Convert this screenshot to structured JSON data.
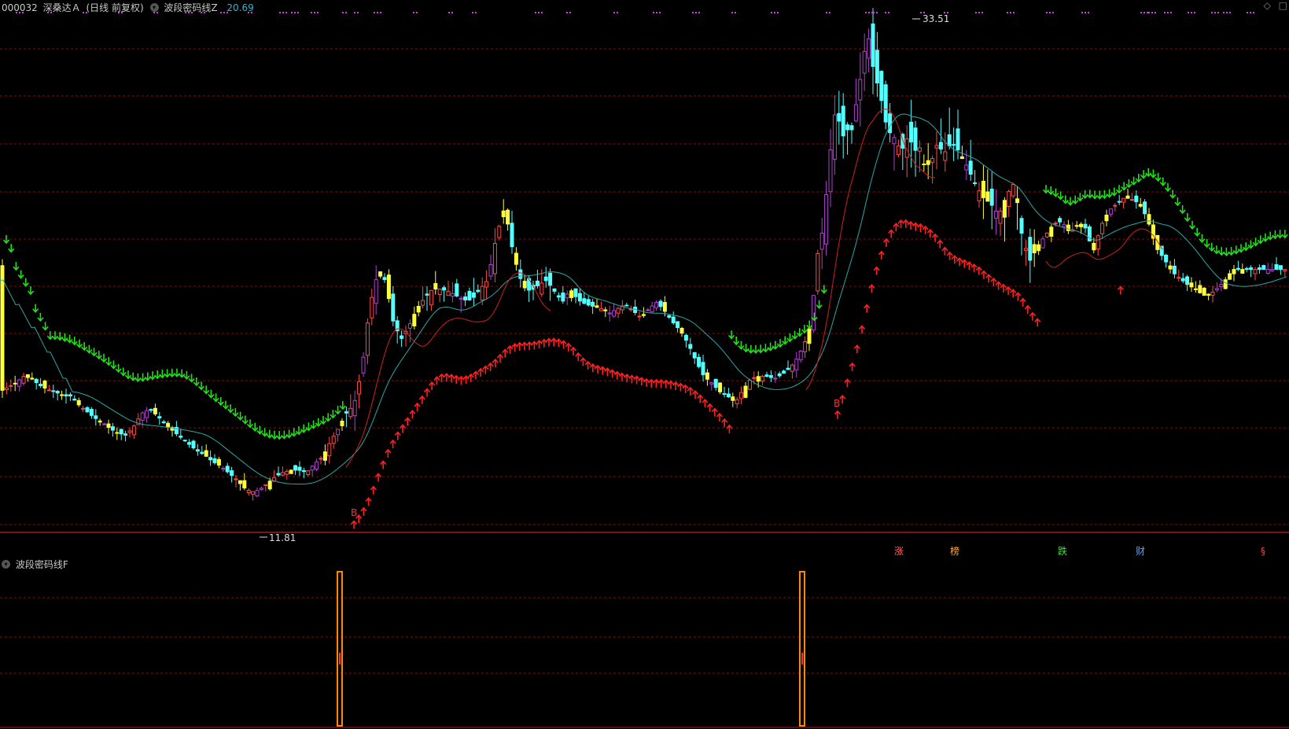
{
  "header": {
    "symbol": "000032",
    "name": "深桑达Ａ",
    "period": "(日线 前复权)",
    "indicator": "波段密码线Z",
    "price": "20.69"
  },
  "sub_panel": {
    "title": "波段密码线F"
  },
  "annotations": {
    "high_label": "33.51",
    "low_label": "11.81",
    "buy_marker": "B"
  },
  "events": [
    "涨",
    "榜",
    "跌",
    "财",
    "§"
  ],
  "colors": {
    "background": "#000000",
    "up": "#ff4a4a",
    "down": "#54ffff",
    "sell_arrow": "#22e01a",
    "buy_arrow": "#ff2020",
    "signal_bar": "#ff8800",
    "grid": "#7a1010",
    "magenta": "#c83ce6",
    "upper_magenta": "#b040d0",
    "yellow": "#ffff40",
    "ma_line": "#2aa8a8",
    "red_line": "#d02020",
    "price_text": "#27b8d8"
  },
  "icons": {
    "collapse": "collapse-icon",
    "diamond": "diamond-icon",
    "pin": "pin-icon"
  },
  "chart_data": {
    "type": "candlestick",
    "y_range": [
      11.0,
      34.5
    ],
    "close_series": [
      [
        0,
        17.2
      ],
      [
        10,
        17.4
      ],
      [
        20,
        17.6
      ],
      [
        30,
        17.9
      ],
      [
        40,
        17.8
      ],
      [
        50,
        17.5
      ],
      [
        60,
        17.3
      ],
      [
        70,
        17.2
      ],
      [
        80,
        17.0
      ],
      [
        90,
        17.0
      ],
      [
        100,
        16.6
      ],
      [
        110,
        16.3
      ],
      [
        120,
        16.0
      ],
      [
        130,
        15.8
      ],
      [
        140,
        15.5
      ],
      [
        150,
        15.3
      ],
      [
        160,
        15.2
      ],
      [
        170,
        15.6
      ],
      [
        180,
        16.2
      ],
      [
        190,
        16.4
      ],
      [
        200,
        16.1
      ],
      [
        210,
        15.7
      ],
      [
        220,
        15.4
      ],
      [
        230,
        15.1
      ],
      [
        240,
        14.8
      ],
      [
        250,
        14.5
      ],
      [
        260,
        14.3
      ],
      [
        270,
        14.0
      ],
      [
        280,
        13.8
      ],
      [
        290,
        13.5
      ],
      [
        300,
        13.2
      ],
      [
        310,
        12.8
      ],
      [
        320,
        12.6
      ],
      [
        330,
        12.7
      ],
      [
        340,
        13.0
      ],
      [
        350,
        13.3
      ],
      [
        360,
        13.5
      ],
      [
        370,
        13.6
      ],
      [
        380,
        13.6
      ],
      [
        390,
        13.5
      ],
      [
        400,
        13.9
      ],
      [
        410,
        14.2
      ],
      [
        420,
        14.9
      ],
      [
        430,
        15.5
      ],
      [
        440,
        16.2
      ],
      [
        450,
        16.6
      ],
      [
        460,
        18.2
      ],
      [
        470,
        21.1
      ],
      [
        480,
        22.6
      ],
      [
        490,
        22.3
      ],
      [
        500,
        20.4
      ],
      [
        510,
        19.6
      ],
      [
        520,
        20.2
      ],
      [
        530,
        21.0
      ],
      [
        540,
        21.5
      ],
      [
        550,
        21.9
      ],
      [
        560,
        21.9
      ],
      [
        570,
        21.8
      ],
      [
        580,
        21.6
      ],
      [
        590,
        21.4
      ],
      [
        600,
        21.4
      ],
      [
        610,
        21.9
      ],
      [
        620,
        22.3
      ],
      [
        630,
        24.1
      ],
      [
        640,
        25.5
      ],
      [
        645,
        25.0
      ],
      [
        650,
        24.0
      ],
      [
        655,
        23.2
      ],
      [
        665,
        22.0
      ],
      [
        675,
        21.8
      ],
      [
        685,
        22.1
      ],
      [
        695,
        22.3
      ],
      [
        705,
        21.8
      ],
      [
        715,
        21.3
      ],
      [
        725,
        21.9
      ],
      [
        735,
        21.4
      ],
      [
        745,
        21.2
      ],
      [
        755,
        21.1
      ],
      [
        765,
        21.0
      ],
      [
        775,
        20.8
      ],
      [
        785,
        21.0
      ],
      [
        795,
        21.2
      ],
      [
        805,
        20.9
      ],
      [
        815,
        20.6
      ],
      [
        825,
        21.0
      ],
      [
        835,
        21.3
      ],
      [
        845,
        20.9
      ],
      [
        855,
        20.4
      ],
      [
        865,
        20.0
      ],
      [
        875,
        19.4
      ],
      [
        885,
        18.6
      ],
      [
        895,
        17.9
      ],
      [
        905,
        17.6
      ],
      [
        915,
        17.2
      ],
      [
        925,
        17.0
      ],
      [
        935,
        16.7
      ],
      [
        945,
        17.3
      ],
      [
        955,
        17.8
      ],
      [
        965,
        17.9
      ],
      [
        975,
        17.9
      ],
      [
        985,
        17.8
      ],
      [
        995,
        18.0
      ],
      [
        1005,
        18.3
      ],
      [
        1015,
        18.8
      ],
      [
        1025,
        19.6
      ],
      [
        1030,
        20.2
      ],
      [
        1035,
        21.8
      ],
      [
        1040,
        23.6
      ],
      [
        1045,
        24.4
      ],
      [
        1050,
        26.0
      ],
      [
        1055,
        27.9
      ],
      [
        1060,
        29.8
      ],
      [
        1065,
        30.1
      ],
      [
        1070,
        28.7
      ],
      [
        1075,
        29.2
      ],
      [
        1080,
        29.2
      ],
      [
        1085,
        29.2
      ],
      [
        1090,
        30.9
      ],
      [
        1095,
        31.7
      ],
      [
        1100,
        33.0
      ],
      [
        1105,
        33.4
      ],
      [
        1110,
        32.1
      ],
      [
        1115,
        31.4
      ],
      [
        1120,
        30.7
      ],
      [
        1125,
        29.7
      ],
      [
        1130,
        29.1
      ],
      [
        1135,
        29.0
      ],
      [
        1140,
        28.6
      ],
      [
        1145,
        28.3
      ],
      [
        1150,
        28.4
      ],
      [
        1155,
        29.0
      ],
      [
        1160,
        28.5
      ],
      [
        1165,
        28.2
      ],
      [
        1170,
        28.4
      ],
      [
        1175,
        27.6
      ],
      [
        1180,
        27.6
      ],
      [
        1185,
        27.8
      ],
      [
        1190,
        28.5
      ],
      [
        1195,
        28.4
      ],
      [
        1200,
        28.1
      ],
      [
        1210,
        28.6
      ],
      [
        1220,
        28.2
      ],
      [
        1230,
        27.5
      ],
      [
        1240,
        26.7
      ],
      [
        1250,
        26.1
      ],
      [
        1260,
        25.8
      ],
      [
        1270,
        25.3
      ],
      [
        1280,
        26.2
      ],
      [
        1290,
        26.8
      ],
      [
        1300,
        24.2
      ],
      [
        1310,
        23.2
      ],
      [
        1320,
        23.9
      ],
      [
        1330,
        24.4
      ],
      [
        1340,
        24.9
      ],
      [
        1350,
        25.0
      ],
      [
        1360,
        24.5
      ],
      [
        1370,
        24.8
      ],
      [
        1380,
        24.7
      ],
      [
        1390,
        23.6
      ],
      [
        1400,
        24.8
      ],
      [
        1410,
        25.5
      ],
      [
        1420,
        25.8
      ],
      [
        1430,
        26.1
      ],
      [
        1440,
        26.0
      ],
      [
        1450,
        25.8
      ],
      [
        1460,
        25.0
      ],
      [
        1470,
        23.8
      ],
      [
        1480,
        23.3
      ],
      [
        1490,
        22.7
      ],
      [
        1500,
        22.4
      ],
      [
        1510,
        22.1
      ],
      [
        1520,
        21.9
      ],
      [
        1530,
        21.6
      ],
      [
        1540,
        21.7
      ],
      [
        1550,
        22.0
      ],
      [
        1560,
        22.4
      ],
      [
        1567,
        22.8
      ]
    ],
    "high": 33.51,
    "low": 11.81,
    "buy_signal_x": [
      432,
      1020
    ]
  }
}
